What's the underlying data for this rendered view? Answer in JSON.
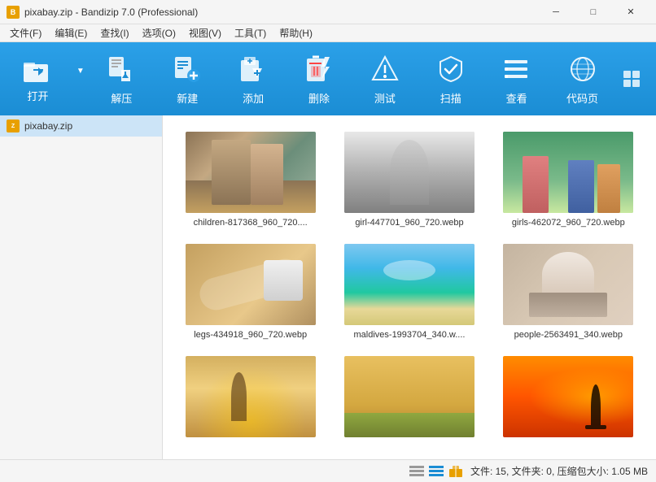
{
  "window": {
    "title": "pixabay.zip - Bandizip 7.0 (Professional)",
    "icon": "B"
  },
  "title_controls": {
    "minimize": "─",
    "maximize": "□",
    "close": "✕"
  },
  "menu": {
    "items": [
      "文件(F)",
      "编辑(E)",
      "查找(I)",
      "选项(O)",
      "视图(V)",
      "工具(T)",
      "帮助(H)"
    ]
  },
  "toolbar": {
    "buttons": [
      {
        "id": "open",
        "label": "打开",
        "has_arrow": true
      },
      {
        "id": "extract",
        "label": "解压"
      },
      {
        "id": "new",
        "label": "新建"
      },
      {
        "id": "add",
        "label": "添加"
      },
      {
        "id": "delete",
        "label": "删除"
      },
      {
        "id": "test",
        "label": "测试"
      },
      {
        "id": "scan",
        "label": "扫描"
      },
      {
        "id": "view",
        "label": "查看"
      },
      {
        "id": "codepage",
        "label": "代码页"
      }
    ],
    "grid_btn": "⊞"
  },
  "sidebar": {
    "items": [
      {
        "id": "pixabay-zip",
        "label": "pixabay.zip",
        "icon": "zip"
      }
    ]
  },
  "files": [
    {
      "id": "children",
      "name": "children-817368_960_720....",
      "thumb_class": "thumb-children"
    },
    {
      "id": "girl",
      "name": "girl-447701_960_720.webp",
      "thumb_class": "thumb-girl"
    },
    {
      "id": "girls",
      "name": "girls-462072_960_720.webp",
      "thumb_class": "thumb-girls"
    },
    {
      "id": "legs",
      "name": "legs-434918_960_720.webp",
      "thumb_class": "thumb-legs"
    },
    {
      "id": "maldives",
      "name": "maldives-1993704_340.w....",
      "thumb_class": "thumb-maldives"
    },
    {
      "id": "people",
      "name": "people-2563491_340.webp",
      "thumb_class": "thumb-people"
    },
    {
      "id": "girl2",
      "name": "",
      "thumb_class": "thumb-girl2"
    },
    {
      "id": "field",
      "name": "",
      "thumb_class": "thumb-field"
    },
    {
      "id": "silhouette",
      "name": "",
      "thumb_class": "thumb-silhouette"
    }
  ],
  "status_bar": {
    "text": "文件: 15, 文件夹: 0, 压缩包大小: 1.05 MB"
  }
}
